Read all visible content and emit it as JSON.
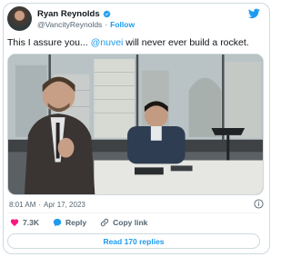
{
  "tweet": {
    "author": {
      "display_name": "Ryan Reynolds",
      "handle": "@VancityReynolds",
      "separator": "·",
      "follow_label": "Follow",
      "verified_icon": "verified-badge-icon"
    },
    "text_before": "This I assure you... ",
    "mention": "@nuvei",
    "text_after": " will never ever build a rocket.",
    "media": {
      "type": "video-still",
      "description_icon": "office-scene"
    },
    "time": "8:01 AM",
    "time_separator": "·",
    "date": "Apr 17, 2023",
    "actions": {
      "like_count": "7.3K",
      "reply_label": "Reply",
      "copy_link_label": "Copy link"
    },
    "read_replies_label": "Read 170 replies"
  },
  "colors": {
    "accent": "#1d9bf0",
    "like": "#f91880",
    "text": "#0f1419",
    "muted": "#536471",
    "border": "#cfd9de"
  },
  "icons": {
    "brand": "twitter-bird-icon",
    "info": "info-icon",
    "like": "heart-icon",
    "reply": "reply-bubble-icon",
    "copy_link": "link-icon"
  }
}
